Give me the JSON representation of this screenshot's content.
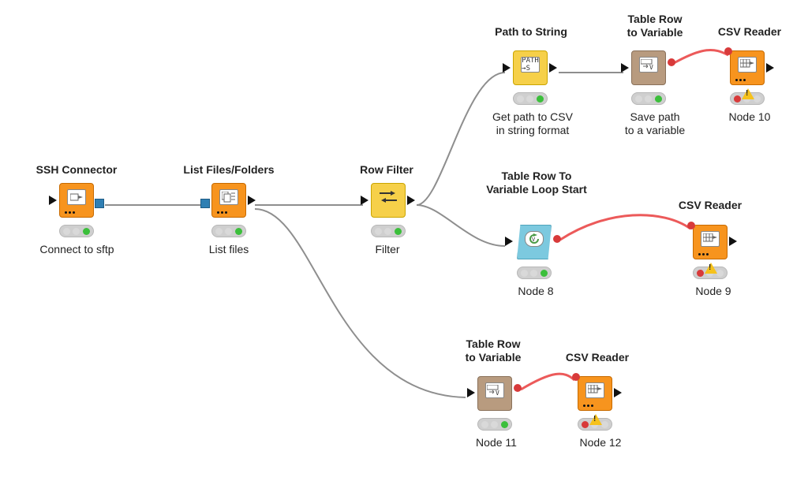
{
  "nodes": {
    "ssh": {
      "title": "SSH Connector",
      "caption": "Connect to sftp",
      "icon_name": "ssh-connector-icon",
      "color": "orange"
    },
    "list": {
      "title": "List Files/Folders",
      "caption": "List files",
      "icon_name": "list-files-icon",
      "color": "orange"
    },
    "filter": {
      "title": "Row Filter",
      "caption": "Filter",
      "icon_name": "row-filter-icon",
      "color": "yellow"
    },
    "path2str": {
      "title": "Path to String",
      "caption": "Get path to CSV\nin string format",
      "icon_name": "path-to-string-icon",
      "color": "yellow"
    },
    "row2var": {
      "title": "Table Row\nto Variable",
      "caption": "Save path\nto a variable",
      "icon_name": "table-row-to-variable-icon",
      "color": "brown"
    },
    "csv10": {
      "title": "CSV Reader",
      "caption": "Node 10",
      "icon_name": "csv-reader-icon",
      "color": "orange"
    },
    "loopstart": {
      "title": "Table Row To\nVariable Loop Start",
      "caption": "Node 8",
      "icon_name": "loop-start-icon",
      "color": "blue-loop"
    },
    "csv9": {
      "title": "CSV Reader",
      "caption": "Node 9",
      "icon_name": "csv-reader-icon",
      "color": "orange"
    },
    "row2var11": {
      "title": "Table Row\nto Variable",
      "caption": "Node 11",
      "icon_name": "table-row-to-variable-icon",
      "color": "brown"
    },
    "csv12": {
      "title": "CSV Reader",
      "caption": "Node 12",
      "icon_name": "csv-reader-icon",
      "color": "orange"
    }
  }
}
